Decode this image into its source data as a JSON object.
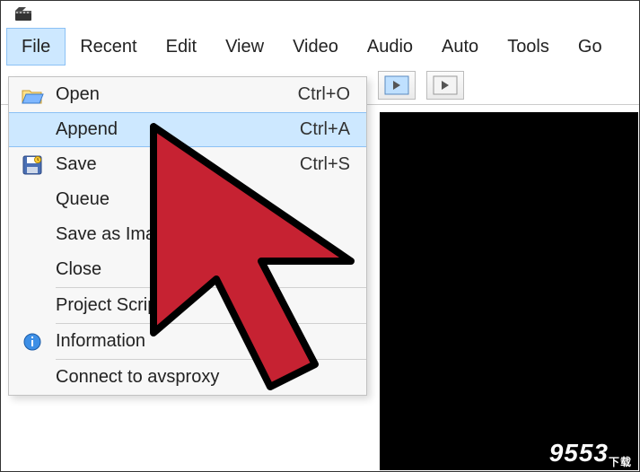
{
  "menubar": {
    "items": [
      {
        "label": "File"
      },
      {
        "label": "Recent"
      },
      {
        "label": "Edit"
      },
      {
        "label": "View"
      },
      {
        "label": "Video"
      },
      {
        "label": "Audio"
      },
      {
        "label": "Auto"
      },
      {
        "label": "Tools"
      },
      {
        "label": "Go"
      }
    ]
  },
  "dropdown": {
    "items": [
      {
        "label": "Open",
        "shortcut": "Ctrl+O",
        "icon": "open"
      },
      {
        "label": "Append",
        "shortcut": "Ctrl+A",
        "hover": true
      },
      {
        "label": "Save",
        "shortcut": "Ctrl+S",
        "icon": "save"
      },
      {
        "label": "Queue"
      },
      {
        "label": "Save as Imag"
      },
      {
        "label": "Close"
      },
      {
        "sep": true
      },
      {
        "label": "Project Script"
      },
      {
        "sep": true
      },
      {
        "label": "Information",
        "icon": "info"
      },
      {
        "sep": true
      },
      {
        "label": "Connect to avsproxy"
      }
    ]
  },
  "watermark": {
    "site": "9553",
    "suffix": "下载"
  }
}
